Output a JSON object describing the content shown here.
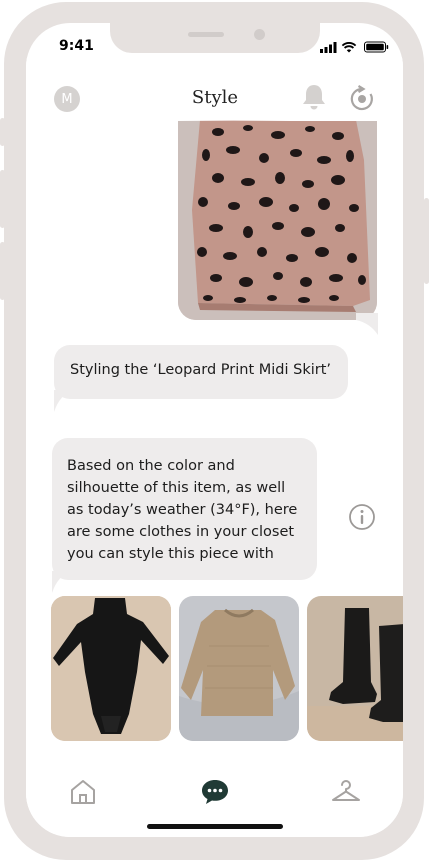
{
  "status_bar": {
    "time": "9:41"
  },
  "header": {
    "avatar_initial": "M",
    "title": "Style"
  },
  "messages": {
    "styling_label": "Styling the ‘Leopard Print Midi Skirt’",
    "suggestion_lines": [
      "Based on the color and",
      "silhouette of this item, as well",
      "as today’s weather (34°F), here",
      "are some clothes in your closet",
      "you can style this piece with"
    ]
  },
  "closet_items": [
    {
      "icon": "black-bodysuit-photo"
    },
    {
      "icon": "beige-sweater-photo"
    },
    {
      "icon": "black-boots-photo"
    }
  ],
  "nav": {
    "items": [
      "home-icon",
      "chat-icon",
      "hanger-icon"
    ]
  },
  "colors": {
    "frame": "#e6e1df",
    "bubble": "#eeecec",
    "accent": "#203a35"
  }
}
